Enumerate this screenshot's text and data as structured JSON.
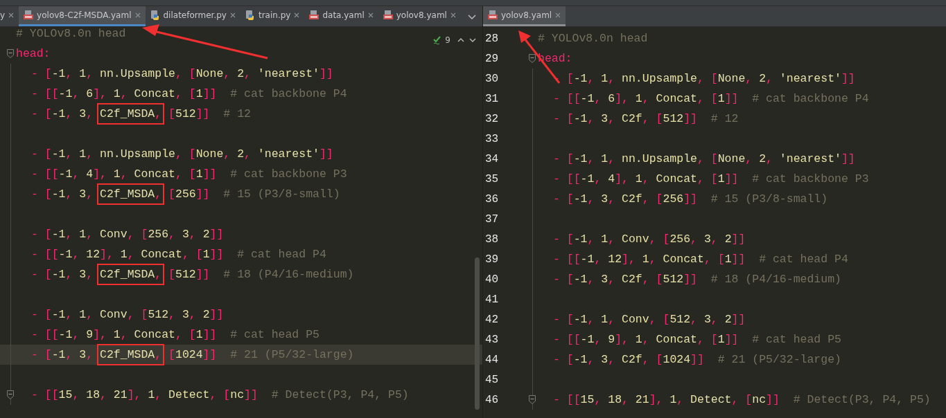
{
  "left_pane": {
    "tabs": [
      {
        "label": "y",
        "kind": "none",
        "selected": false
      },
      {
        "label": "yolov8-C2f-MSDA.yaml",
        "kind": "yaml",
        "selected": true
      },
      {
        "label": "dilateformer.py",
        "kind": "python",
        "selected": false
      },
      {
        "label": "train.py",
        "kind": "python",
        "selected": false
      },
      {
        "label": "data.yaml",
        "kind": "yaml",
        "selected": false
      },
      {
        "label": "yolov8.yaml",
        "kind": "yaml",
        "selected": false
      }
    ],
    "inspections": {
      "count": "9"
    },
    "lines": [
      {
        "kind": "code",
        "tokens": [
          {
            "kind": "c",
            "text": "# YOLOv8.0n head"
          }
        ]
      },
      {
        "kind": "code",
        "fold": true,
        "tokens": [
          {
            "kind": "k",
            "text": "head:"
          }
        ],
        "children": [
          {
            "kind": "code",
            "tokens": [
              {
                "kind": "p",
                "text": "- ["
              },
              {
                "kind": "v",
                "text": "-1"
              },
              {
                "kind": "p",
                "text": ", "
              },
              {
                "kind": "v",
                "text": "1"
              },
              {
                "kind": "p",
                "text": ", "
              },
              {
                "kind": "v",
                "text": "nn.Upsample"
              },
              {
                "kind": "p",
                "text": ", ["
              },
              {
                "kind": "v",
                "text": "None"
              },
              {
                "kind": "p",
                "text": ", "
              },
              {
                "kind": "v",
                "text": "2"
              },
              {
                "kind": "p",
                "text": ", "
              },
              {
                "kind": "v",
                "text": "'nearest'"
              },
              {
                "kind": "p",
                "text": "]]"
              }
            ]
          },
          {
            "kind": "code",
            "tokens": [
              {
                "kind": "p",
                "text": "- [["
              },
              {
                "kind": "v",
                "text": "-1"
              },
              {
                "kind": "p",
                "text": ", "
              },
              {
                "kind": "v",
                "text": "6"
              },
              {
                "kind": "p",
                "text": "], "
              },
              {
                "kind": "v",
                "text": "1"
              },
              {
                "kind": "p",
                "text": ", "
              },
              {
                "kind": "v",
                "text": "Concat"
              },
              {
                "kind": "p",
                "text": ", ["
              },
              {
                "kind": "v",
                "text": "1"
              },
              {
                "kind": "p",
                "text": "]]"
              },
              {
                "kind": "c",
                "text": "  # cat backbone P4"
              }
            ]
          },
          {
            "kind": "code",
            "tokens": [
              {
                "kind": "p",
                "text": "- ["
              },
              {
                "kind": "v",
                "text": "-1"
              },
              {
                "kind": "p",
                "text": ", "
              },
              {
                "kind": "v",
                "text": "3"
              },
              {
                "kind": "p",
                "text": ", "
              },
              {
                "kind": "box",
                "parts": [
                  {
                    "kind": "v",
                    "text": "C2f_MSDA"
                  },
                  {
                    "kind": "p",
                    "text": ","
                  }
                ]
              },
              {
                "kind": "p",
                "text": " ["
              },
              {
                "kind": "v",
                "text": "512"
              },
              {
                "kind": "p",
                "text": "]]"
              },
              {
                "kind": "c",
                "text": "  # 12"
              }
            ]
          },
          {
            "kind": "blank"
          },
          {
            "kind": "code",
            "tokens": [
              {
                "kind": "p",
                "text": "- ["
              },
              {
                "kind": "v",
                "text": "-1"
              },
              {
                "kind": "p",
                "text": ", "
              },
              {
                "kind": "v",
                "text": "1"
              },
              {
                "kind": "p",
                "text": ", "
              },
              {
                "kind": "v",
                "text": "nn.Upsample"
              },
              {
                "kind": "p",
                "text": ", ["
              },
              {
                "kind": "v",
                "text": "None"
              },
              {
                "kind": "p",
                "text": ", "
              },
              {
                "kind": "v",
                "text": "2"
              },
              {
                "kind": "p",
                "text": ", "
              },
              {
                "kind": "v",
                "text": "'nearest'"
              },
              {
                "kind": "p",
                "text": "]]"
              }
            ]
          },
          {
            "kind": "code",
            "tokens": [
              {
                "kind": "p",
                "text": "- [["
              },
              {
                "kind": "v",
                "text": "-1"
              },
              {
                "kind": "p",
                "text": ", "
              },
              {
                "kind": "v",
                "text": "4"
              },
              {
                "kind": "p",
                "text": "], "
              },
              {
                "kind": "v",
                "text": "1"
              },
              {
                "kind": "p",
                "text": ", "
              },
              {
                "kind": "v",
                "text": "Concat"
              },
              {
                "kind": "p",
                "text": ", ["
              },
              {
                "kind": "v",
                "text": "1"
              },
              {
                "kind": "p",
                "text": "]]"
              },
              {
                "kind": "c",
                "text": "  # cat backbone P3"
              }
            ]
          },
          {
            "kind": "code",
            "tokens": [
              {
                "kind": "p",
                "text": "- ["
              },
              {
                "kind": "v",
                "text": "-1"
              },
              {
                "kind": "p",
                "text": ", "
              },
              {
                "kind": "v",
                "text": "3"
              },
              {
                "kind": "p",
                "text": ", "
              },
              {
                "kind": "box",
                "parts": [
                  {
                    "kind": "v",
                    "text": "C2f_MSDA"
                  },
                  {
                    "kind": "p",
                    "text": ","
                  }
                ]
              },
              {
                "kind": "p",
                "text": " ["
              },
              {
                "kind": "v",
                "text": "256"
              },
              {
                "kind": "p",
                "text": "]]"
              },
              {
                "kind": "c",
                "text": "  # 15 (P3/8-small)"
              }
            ]
          },
          {
            "kind": "blank"
          },
          {
            "kind": "code",
            "tokens": [
              {
                "kind": "p",
                "text": "- ["
              },
              {
                "kind": "v",
                "text": "-1"
              },
              {
                "kind": "p",
                "text": ", "
              },
              {
                "kind": "v",
                "text": "1"
              },
              {
                "kind": "p",
                "text": ", "
              },
              {
                "kind": "v",
                "text": "Conv"
              },
              {
                "kind": "p",
                "text": ", ["
              },
              {
                "kind": "v",
                "text": "256"
              },
              {
                "kind": "p",
                "text": ", "
              },
              {
                "kind": "v",
                "text": "3"
              },
              {
                "kind": "p",
                "text": ", "
              },
              {
                "kind": "v",
                "text": "2"
              },
              {
                "kind": "p",
                "text": "]]"
              }
            ]
          },
          {
            "kind": "code",
            "tokens": [
              {
                "kind": "p",
                "text": "- [["
              },
              {
                "kind": "v",
                "text": "-1"
              },
              {
                "kind": "p",
                "text": ", "
              },
              {
                "kind": "v",
                "text": "12"
              },
              {
                "kind": "p",
                "text": "], "
              },
              {
                "kind": "v",
                "text": "1"
              },
              {
                "kind": "p",
                "text": ", "
              },
              {
                "kind": "v",
                "text": "Concat"
              },
              {
                "kind": "p",
                "text": ", ["
              },
              {
                "kind": "v",
                "text": "1"
              },
              {
                "kind": "p",
                "text": "]]"
              },
              {
                "kind": "c",
                "text": "  # cat head P4"
              }
            ]
          },
          {
            "kind": "code",
            "tokens": [
              {
                "kind": "p",
                "text": "- ["
              },
              {
                "kind": "v",
                "text": "-1"
              },
              {
                "kind": "p",
                "text": ", "
              },
              {
                "kind": "v",
                "text": "3"
              },
              {
                "kind": "p",
                "text": ", "
              },
              {
                "kind": "box",
                "parts": [
                  {
                    "kind": "v",
                    "text": "C2f_MSDA"
                  },
                  {
                    "kind": "p",
                    "text": ","
                  }
                ]
              },
              {
                "kind": "p",
                "text": " ["
              },
              {
                "kind": "v",
                "text": "512"
              },
              {
                "kind": "p",
                "text": "]]"
              },
              {
                "kind": "c",
                "text": "  # 18 (P4/16-medium)"
              }
            ]
          },
          {
            "kind": "blank"
          },
          {
            "kind": "code",
            "tokens": [
              {
                "kind": "p",
                "text": "- ["
              },
              {
                "kind": "v",
                "text": "-1"
              },
              {
                "kind": "p",
                "text": ", "
              },
              {
                "kind": "v",
                "text": "1"
              },
              {
                "kind": "p",
                "text": ", "
              },
              {
                "kind": "v",
                "text": "Conv"
              },
              {
                "kind": "p",
                "text": ", ["
              },
              {
                "kind": "v",
                "text": "512"
              },
              {
                "kind": "p",
                "text": ", "
              },
              {
                "kind": "v",
                "text": "3"
              },
              {
                "kind": "p",
                "text": ", "
              },
              {
                "kind": "v",
                "text": "2"
              },
              {
                "kind": "p",
                "text": "]]"
              }
            ]
          },
          {
            "kind": "code",
            "tokens": [
              {
                "kind": "p",
                "text": "- [["
              },
              {
                "kind": "v",
                "text": "-1"
              },
              {
                "kind": "p",
                "text": ", "
              },
              {
                "kind": "v",
                "text": "9"
              },
              {
                "kind": "p",
                "text": "], "
              },
              {
                "kind": "v",
                "text": "1"
              },
              {
                "kind": "p",
                "text": ", "
              },
              {
                "kind": "v",
                "text": "Concat"
              },
              {
                "kind": "p",
                "text": ", ["
              },
              {
                "kind": "v",
                "text": "1"
              },
              {
                "kind": "p",
                "text": "]]"
              },
              {
                "kind": "c",
                "text": "  # cat head P5"
              }
            ]
          },
          {
            "kind": "code",
            "current": true,
            "tokens": [
              {
                "kind": "p",
                "text": "- ["
              },
              {
                "kind": "v",
                "text": "-1"
              },
              {
                "kind": "p",
                "text": ", "
              },
              {
                "kind": "v",
                "text": "3"
              },
              {
                "kind": "p",
                "text": ", "
              },
              {
                "kind": "box",
                "parts": [
                  {
                    "kind": "v",
                    "text": "C2f_MSDA"
                  },
                  {
                    "kind": "p",
                    "text": ","
                  }
                ]
              },
              {
                "kind": "p",
                "text": " ["
              },
              {
                "kind": "v",
                "text": "1024"
              },
              {
                "kind": "p",
                "text": "]]"
              },
              {
                "kind": "c",
                "text": "  # 21 (P5/32-large)"
              }
            ]
          },
          {
            "kind": "blank"
          },
          {
            "kind": "code",
            "fold": true,
            "tokens": [
              {
                "kind": "p",
                "text": "- [["
              },
              {
                "kind": "v",
                "text": "15"
              },
              {
                "kind": "p",
                "text": ", "
              },
              {
                "kind": "v",
                "text": "18"
              },
              {
                "kind": "p",
                "text": ", "
              },
              {
                "kind": "v",
                "text": "21"
              },
              {
                "kind": "p",
                "text": "], "
              },
              {
                "kind": "v",
                "text": "1"
              },
              {
                "kind": "p",
                "text": ", "
              },
              {
                "kind": "v",
                "text": "Detect"
              },
              {
                "kind": "p",
                "text": ", ["
              },
              {
                "kind": "v",
                "text": "nc"
              },
              {
                "kind": "p",
                "text": "]]"
              },
              {
                "kind": "c",
                "text": "  # Detect(P3, P4, P5)"
              }
            ]
          }
        ]
      }
    ]
  },
  "right_pane": {
    "tabs": [
      {
        "label": "yolov8.yaml",
        "kind": "yaml",
        "selected": true
      }
    ],
    "lines": [
      {
        "kind": "code",
        "number": "28",
        "tokens": [
          {
            "kind": "c",
            "text": "# YOLOv8.0n head"
          }
        ]
      },
      {
        "kind": "code",
        "number": "29",
        "fold": true,
        "tokens": [
          {
            "kind": "k",
            "text": "head:"
          }
        ],
        "children": [
          {
            "kind": "code",
            "number": "30",
            "tokens": [
              {
                "kind": "p",
                "text": "- ["
              },
              {
                "kind": "v",
                "text": "-1"
              },
              {
                "kind": "p",
                "text": ", "
              },
              {
                "kind": "v",
                "text": "1"
              },
              {
                "kind": "p",
                "text": ", "
              },
              {
                "kind": "v",
                "text": "nn.Upsample"
              },
              {
                "kind": "p",
                "text": ", ["
              },
              {
                "kind": "v",
                "text": "None"
              },
              {
                "kind": "p",
                "text": ", "
              },
              {
                "kind": "v",
                "text": "2"
              },
              {
                "kind": "p",
                "text": ", "
              },
              {
                "kind": "v",
                "text": "'nearest'"
              },
              {
                "kind": "p",
                "text": "]]"
              }
            ]
          },
          {
            "kind": "code",
            "number": "31",
            "tokens": [
              {
                "kind": "p",
                "text": "- [["
              },
              {
                "kind": "v",
                "text": "-1"
              },
              {
                "kind": "p",
                "text": ", "
              },
              {
                "kind": "v",
                "text": "6"
              },
              {
                "kind": "p",
                "text": "], "
              },
              {
                "kind": "v",
                "text": "1"
              },
              {
                "kind": "p",
                "text": ", "
              },
              {
                "kind": "v",
                "text": "Concat"
              },
              {
                "kind": "p",
                "text": ", ["
              },
              {
                "kind": "v",
                "text": "1"
              },
              {
                "kind": "p",
                "text": "]]"
              },
              {
                "kind": "c",
                "text": "  # cat backbone P4"
              }
            ]
          },
          {
            "kind": "code",
            "number": "32",
            "tokens": [
              {
                "kind": "p",
                "text": "- ["
              },
              {
                "kind": "v",
                "text": "-1"
              },
              {
                "kind": "p",
                "text": ", "
              },
              {
                "kind": "v",
                "text": "3"
              },
              {
                "kind": "p",
                "text": ", "
              },
              {
                "kind": "v",
                "text": "C2f"
              },
              {
                "kind": "p",
                "text": ", ["
              },
              {
                "kind": "v",
                "text": "512"
              },
              {
                "kind": "p",
                "text": "]]"
              },
              {
                "kind": "c",
                "text": "  # 12"
              }
            ]
          },
          {
            "kind": "blank",
            "number": "33"
          },
          {
            "kind": "code",
            "number": "34",
            "tokens": [
              {
                "kind": "p",
                "text": "- ["
              },
              {
                "kind": "v",
                "text": "-1"
              },
              {
                "kind": "p",
                "text": ", "
              },
              {
                "kind": "v",
                "text": "1"
              },
              {
                "kind": "p",
                "text": ", "
              },
              {
                "kind": "v",
                "text": "nn.Upsample"
              },
              {
                "kind": "p",
                "text": ", ["
              },
              {
                "kind": "v",
                "text": "None"
              },
              {
                "kind": "p",
                "text": ", "
              },
              {
                "kind": "v",
                "text": "2"
              },
              {
                "kind": "p",
                "text": ", "
              },
              {
                "kind": "v",
                "text": "'nearest'"
              },
              {
                "kind": "p",
                "text": "]]"
              }
            ]
          },
          {
            "kind": "code",
            "number": "35",
            "tokens": [
              {
                "kind": "p",
                "text": "- [["
              },
              {
                "kind": "v",
                "text": "-1"
              },
              {
                "kind": "p",
                "text": ", "
              },
              {
                "kind": "v",
                "text": "4"
              },
              {
                "kind": "p",
                "text": "], "
              },
              {
                "kind": "v",
                "text": "1"
              },
              {
                "kind": "p",
                "text": ", "
              },
              {
                "kind": "v",
                "text": "Concat"
              },
              {
                "kind": "p",
                "text": ", ["
              },
              {
                "kind": "v",
                "text": "1"
              },
              {
                "kind": "p",
                "text": "]]"
              },
              {
                "kind": "c",
                "text": "  # cat backbone P3"
              }
            ]
          },
          {
            "kind": "code",
            "number": "36",
            "tokens": [
              {
                "kind": "p",
                "text": "- ["
              },
              {
                "kind": "v",
                "text": "-1"
              },
              {
                "kind": "p",
                "text": ", "
              },
              {
                "kind": "v",
                "text": "3"
              },
              {
                "kind": "p",
                "text": ", "
              },
              {
                "kind": "v",
                "text": "C2f"
              },
              {
                "kind": "p",
                "text": ", ["
              },
              {
                "kind": "v",
                "text": "256"
              },
              {
                "kind": "p",
                "text": "]]"
              },
              {
                "kind": "c",
                "text": "  # 15 (P3/8-small)"
              }
            ]
          },
          {
            "kind": "blank",
            "number": "37"
          },
          {
            "kind": "code",
            "number": "38",
            "tokens": [
              {
                "kind": "p",
                "text": "- ["
              },
              {
                "kind": "v",
                "text": "-1"
              },
              {
                "kind": "p",
                "text": ", "
              },
              {
                "kind": "v",
                "text": "1"
              },
              {
                "kind": "p",
                "text": ", "
              },
              {
                "kind": "v",
                "text": "Conv"
              },
              {
                "kind": "p",
                "text": ", ["
              },
              {
                "kind": "v",
                "text": "256"
              },
              {
                "kind": "p",
                "text": ", "
              },
              {
                "kind": "v",
                "text": "3"
              },
              {
                "kind": "p",
                "text": ", "
              },
              {
                "kind": "v",
                "text": "2"
              },
              {
                "kind": "p",
                "text": "]]"
              }
            ]
          },
          {
            "kind": "code",
            "number": "39",
            "tokens": [
              {
                "kind": "p",
                "text": "- [["
              },
              {
                "kind": "v",
                "text": "-1"
              },
              {
                "kind": "p",
                "text": ", "
              },
              {
                "kind": "v",
                "text": "12"
              },
              {
                "kind": "p",
                "text": "], "
              },
              {
                "kind": "v",
                "text": "1"
              },
              {
                "kind": "p",
                "text": ", "
              },
              {
                "kind": "v",
                "text": "Concat"
              },
              {
                "kind": "p",
                "text": ", ["
              },
              {
                "kind": "v",
                "text": "1"
              },
              {
                "kind": "p",
                "text": "]]"
              },
              {
                "kind": "c",
                "text": "  # cat head P4"
              }
            ]
          },
          {
            "kind": "code",
            "number": "40",
            "tokens": [
              {
                "kind": "p",
                "text": "- ["
              },
              {
                "kind": "v",
                "text": "-1"
              },
              {
                "kind": "p",
                "text": ", "
              },
              {
                "kind": "v",
                "text": "3"
              },
              {
                "kind": "p",
                "text": ", "
              },
              {
                "kind": "v",
                "text": "C2f"
              },
              {
                "kind": "p",
                "text": ", ["
              },
              {
                "kind": "v",
                "text": "512"
              },
              {
                "kind": "p",
                "text": "]]"
              },
              {
                "kind": "c",
                "text": "  # 18 (P4/16-medium)"
              }
            ]
          },
          {
            "kind": "blank",
            "number": "41"
          },
          {
            "kind": "code",
            "number": "42",
            "tokens": [
              {
                "kind": "p",
                "text": "- ["
              },
              {
                "kind": "v",
                "text": "-1"
              },
              {
                "kind": "p",
                "text": ", "
              },
              {
                "kind": "v",
                "text": "1"
              },
              {
                "kind": "p",
                "text": ", "
              },
              {
                "kind": "v",
                "text": "Conv"
              },
              {
                "kind": "p",
                "text": ", ["
              },
              {
                "kind": "v",
                "text": "512"
              },
              {
                "kind": "p",
                "text": ", "
              },
              {
                "kind": "v",
                "text": "3"
              },
              {
                "kind": "p",
                "text": ", "
              },
              {
                "kind": "v",
                "text": "2"
              },
              {
                "kind": "p",
                "text": "]]"
              }
            ]
          },
          {
            "kind": "code",
            "number": "43",
            "tokens": [
              {
                "kind": "p",
                "text": "- [["
              },
              {
                "kind": "v",
                "text": "-1"
              },
              {
                "kind": "p",
                "text": ", "
              },
              {
                "kind": "v",
                "text": "9"
              },
              {
                "kind": "p",
                "text": "], "
              },
              {
                "kind": "v",
                "text": "1"
              },
              {
                "kind": "p",
                "text": ", "
              },
              {
                "kind": "v",
                "text": "Concat"
              },
              {
                "kind": "p",
                "text": ", ["
              },
              {
                "kind": "v",
                "text": "1"
              },
              {
                "kind": "p",
                "text": "]]"
              },
              {
                "kind": "c",
                "text": "  # cat head P5"
              }
            ]
          },
          {
            "kind": "code",
            "number": "44",
            "tokens": [
              {
                "kind": "p",
                "text": "- ["
              },
              {
                "kind": "v",
                "text": "-1"
              },
              {
                "kind": "p",
                "text": ", "
              },
              {
                "kind": "v",
                "text": "3"
              },
              {
                "kind": "p",
                "text": ", "
              },
              {
                "kind": "v",
                "text": "C2f"
              },
              {
                "kind": "p",
                "text": ", ["
              },
              {
                "kind": "v",
                "text": "1024"
              },
              {
                "kind": "p",
                "text": "]]"
              },
              {
                "kind": "c",
                "text": "  # 21 (P5/32-large)"
              }
            ]
          },
          {
            "kind": "blank",
            "number": "45"
          },
          {
            "kind": "code",
            "number": "46",
            "fold": true,
            "tokens": [
              {
                "kind": "p",
                "text": "- [["
              },
              {
                "kind": "v",
                "text": "15"
              },
              {
                "kind": "p",
                "text": ", "
              },
              {
                "kind": "v",
                "text": "18"
              },
              {
                "kind": "p",
                "text": ", "
              },
              {
                "kind": "v",
                "text": "21"
              },
              {
                "kind": "p",
                "text": "], "
              },
              {
                "kind": "v",
                "text": "1"
              },
              {
                "kind": "p",
                "text": ", "
              },
              {
                "kind": "v",
                "text": "Detect"
              },
              {
                "kind": "p",
                "text": ", ["
              },
              {
                "kind": "v",
                "text": "nc"
              },
              {
                "kind": "p",
                "text": "]]"
              },
              {
                "kind": "c",
                "text": "  # Detect(P3, P4, P5)"
              }
            ]
          }
        ]
      }
    ]
  }
}
